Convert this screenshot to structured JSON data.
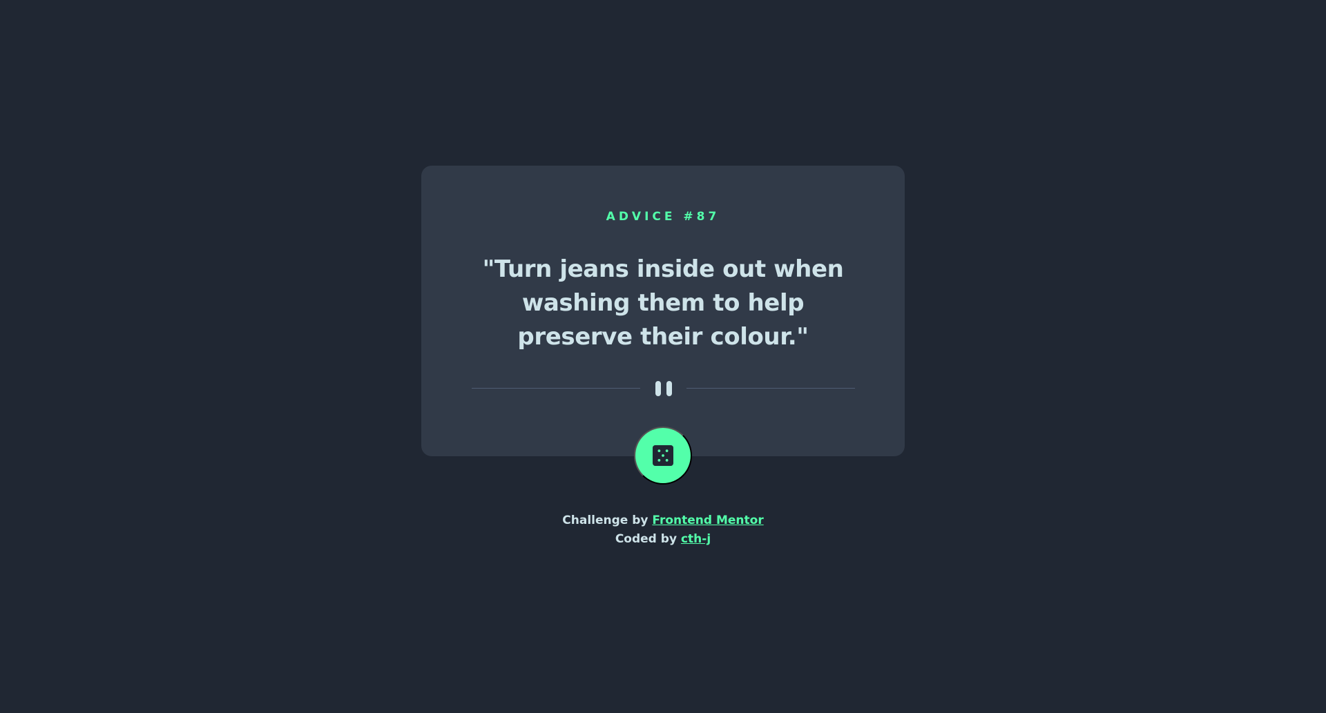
{
  "advice": {
    "id_label": "ADVICE #87",
    "text": "\"Turn jeans inside out when washing them to help preserve their colour.\""
  },
  "dice_button": {
    "icon": "dice-icon"
  },
  "attribution": {
    "challenge_prefix": "Challenge by",
    "challenge_link": "Frontend Mentor",
    "coded_prefix": "Coded by",
    "coded_link": "cth-j"
  },
  "colors": {
    "background": "#202733",
    "card": "#313a48",
    "accent": "#53ffaa",
    "text": "#cee3e9",
    "divider": "#4f5d74"
  }
}
